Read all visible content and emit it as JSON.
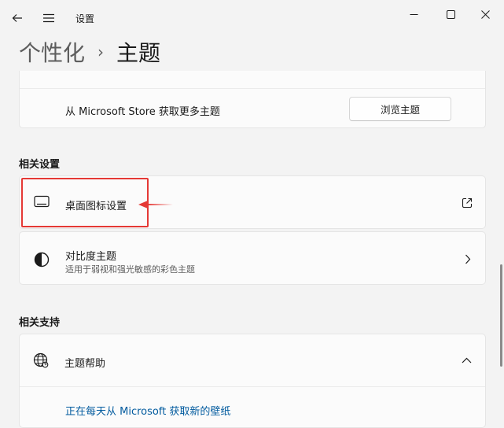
{
  "window": {
    "app_title": "设置"
  },
  "breadcrumb": {
    "parent": "个性化",
    "separator": "›",
    "current": "主题"
  },
  "store_row": {
    "text": "从 Microsoft Store 获取更多主题",
    "button_label": "浏览主题"
  },
  "related_settings": {
    "heading": "相关设置",
    "items": [
      {
        "title": "桌面图标设置",
        "icon": "monitor-icon",
        "action_icon": "external-link-icon"
      },
      {
        "title": "对比度主题",
        "subtitle": "适用于弱视和强光敏感的彩色主题",
        "icon": "contrast-icon",
        "action_icon": "chevron-right-icon"
      }
    ]
  },
  "related_support": {
    "heading": "相关支持",
    "items": [
      {
        "title": "主题帮助",
        "icon": "globe-icon",
        "action_icon": "chevron-up-icon",
        "expanded": true
      }
    ],
    "link": "正在每天从 Microsoft 获取新的壁纸"
  },
  "colors": {
    "background": "#f3f3f3",
    "card": "#fbfbfb",
    "highlight": "#e53935",
    "link": "#005a9e"
  }
}
